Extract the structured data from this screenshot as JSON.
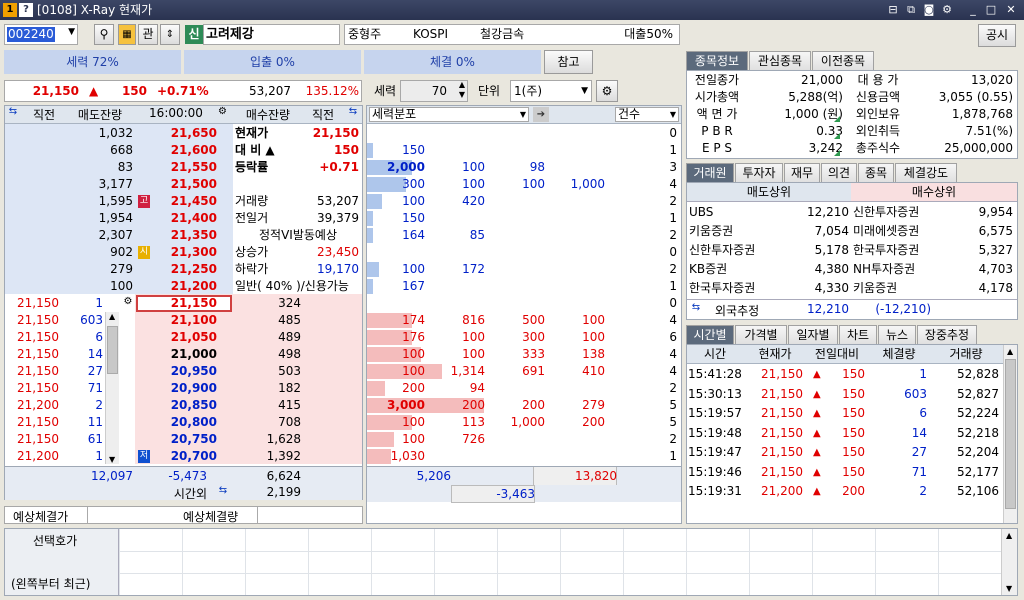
{
  "window": {
    "title": "[0108] X-Ray 현재가"
  },
  "toolbar": {
    "code": "002240",
    "gwan": "관",
    "sin": "신",
    "name": "고려제강",
    "sector1": "중형주",
    "sector2": "KOSPI",
    "sector3": "철강금속",
    "loan": "대출50%",
    "gongsi": "공시",
    "chamgo": "참고"
  },
  "power": {
    "seryeok": "세력 72%",
    "ipchul": "입출 0%",
    "chegyeol": "체결 0%"
  },
  "price_line": {
    "price": "21,150",
    "arrow": "▲",
    "diff": "150",
    "pct": "+0.71%",
    "volume": "53,207",
    "ratio": "135.12%"
  },
  "seryeok_ctl": {
    "label": "세력",
    "value": "70",
    "unit_label": "단위",
    "unit": "1(주)"
  },
  "hoga_header": {
    "col1": "직전",
    "col2": "매도잔량",
    "time": "16:00:00",
    "col4": "매수잔량",
    "col5": "직전"
  },
  "ask": [
    {
      "qty": "1,032",
      "price": "21,650",
      "mark": ""
    },
    {
      "qty": "668",
      "price": "21,600",
      "mark": ""
    },
    {
      "qty": "83",
      "price": "21,550",
      "mark": ""
    },
    {
      "qty": "3,177",
      "price": "21,500",
      "mark": ""
    },
    {
      "qty": "1,595",
      "price": "21,450",
      "mark": "고"
    },
    {
      "qty": "1,954",
      "price": "21,400",
      "mark": ""
    },
    {
      "qty": "2,307",
      "price": "21,350",
      "mark": ""
    },
    {
      "qty": "902",
      "price": "21,300",
      "mark": "시"
    },
    {
      "qty": "279",
      "price": "21,250",
      "mark": ""
    },
    {
      "qty": "100",
      "price": "21,200",
      "mark": ""
    }
  ],
  "bid": [
    {
      "price": "21,150",
      "qty": "324",
      "mark": ""
    },
    {
      "price": "21,100",
      "qty": "485",
      "mark": ""
    },
    {
      "price": "21,050",
      "qty": "489",
      "mark": ""
    },
    {
      "price": "21,000",
      "qty": "498",
      "mark": ""
    },
    {
      "price": "20,950",
      "qty": "503",
      "mark": ""
    },
    {
      "price": "20,900",
      "qty": "182",
      "mark": ""
    },
    {
      "price": "20,850",
      "qty": "415",
      "mark": ""
    },
    {
      "price": "20,800",
      "qty": "708",
      "mark": ""
    },
    {
      "price": "20,750",
      "qty": "1,628",
      "mark": ""
    },
    {
      "price": "20,700",
      "qty": "1,392",
      "mark": "저"
    }
  ],
  "ticks": [
    {
      "p": "21,150",
      "q": "1"
    },
    {
      "p": "21,150",
      "q": "603"
    },
    {
      "p": "21,150",
      "q": "6"
    },
    {
      "p": "21,150",
      "q": "14"
    },
    {
      "p": "21,150",
      "q": "27"
    },
    {
      "p": "21,150",
      "q": "71"
    },
    {
      "p": "21,200",
      "q": "2"
    },
    {
      "p": "21,150",
      "q": "11"
    },
    {
      "p": "21,150",
      "q": "61"
    },
    {
      "p": "21,200",
      "q": "1"
    }
  ],
  "summary_info": [
    {
      "label": "현재가",
      "value": "21,150",
      "cls": "red bold"
    },
    {
      "label": "대 비 ▲",
      "value": "150",
      "cls": "red bold"
    },
    {
      "label": "등락률",
      "value": "+0.71",
      "cls": "red bold"
    },
    {
      "label": "",
      "value": "",
      "cls": ""
    },
    {
      "label": "거래량",
      "value": "53,207",
      "cls": ""
    },
    {
      "label": "전일거",
      "value": "39,379",
      "cls": ""
    },
    {
      "label": "정적VI발동예상",
      "value": "",
      "cls": ""
    },
    {
      "label": "상승가",
      "value": "23,450",
      "cls": "red"
    },
    {
      "label": "하락가",
      "value": "19,170",
      "cls": "blue"
    },
    {
      "label": "일반( 40% )/신용가능",
      "value": "",
      "cls": ""
    }
  ],
  "totals": {
    "ask_total": "12,097",
    "diff": "-5,473",
    "bid_total": "6,624",
    "after_label": "시간외",
    "after_qty": "2,199"
  },
  "expected": {
    "price_label": "예상체결가",
    "qty_label": "예상체결량"
  },
  "dist_header": {
    "label": "세력분포",
    "count": "건수"
  },
  "dist": [
    {
      "v": [
        "",
        "",
        "",
        ""
      ],
      "cnt": "0"
    },
    {
      "v": [
        "150",
        "",
        "",
        ""
      ],
      "cnt": "1"
    },
    {
      "v": [
        "2,000",
        "100",
        "98",
        ""
      ],
      "cnt": "3"
    },
    {
      "v": [
        "300",
        "100",
        "100",
        "1,000"
      ],
      "cnt": "4"
    },
    {
      "v": [
        "100",
        "420",
        "",
        ""
      ],
      "cnt": "2"
    },
    {
      "v": [
        "150",
        "",
        "",
        ""
      ],
      "cnt": "1"
    },
    {
      "v": [
        "164",
        "85",
        "",
        ""
      ],
      "cnt": "2"
    },
    {
      "v": [
        "",
        "",
        "",
        ""
      ],
      "cnt": "0"
    },
    {
      "v": [
        "100",
        "172",
        "",
        ""
      ],
      "cnt": "2"
    },
    {
      "v": [
        "167",
        "",
        "",
        ""
      ],
      "cnt": "1"
    },
    {
      "v": [
        "",
        "",
        "",
        ""
      ],
      "cnt": "0"
    },
    {
      "v": [
        "174",
        "816",
        "500",
        "100"
      ],
      "cnt": "4"
    },
    {
      "v": [
        "176",
        "100",
        "300",
        "100"
      ],
      "cnt": "6"
    },
    {
      "v": [
        "100",
        "100",
        "333",
        "138"
      ],
      "cnt": "4"
    },
    {
      "v": [
        "100",
        "1,314",
        "691",
        "410"
      ],
      "cnt": "4"
    },
    {
      "v": [
        "200",
        "94",
        "",
        ""
      ],
      "cnt": "2"
    },
    {
      "v": [
        "3,000",
        "200",
        "200",
        "279"
      ],
      "cnt": "5"
    },
    {
      "v": [
        "100",
        "113",
        "1,000",
        "200"
      ],
      "cnt": "5"
    },
    {
      "v": [
        "100",
        "726",
        "",
        ""
      ],
      "cnt": "2"
    },
    {
      "v": [
        "1,030",
        "",
        "",
        ""
      ],
      "cnt": "1"
    }
  ],
  "dist_bars": [
    0,
    0.04,
    0.3,
    0.26,
    0.1,
    0.04,
    0.04,
    0,
    0.08,
    0.04,
    0,
    0.3,
    0.3,
    0.36,
    0.5,
    0.12,
    0.78,
    0.3,
    0.18,
    0.16
  ],
  "dist_total": {
    "ask": "5,206",
    "bid": "13,820",
    "diff": "-3,463"
  },
  "info_tabs": [
    "종목정보",
    "관심종목",
    "이전종목"
  ],
  "info": [
    [
      "전일종가",
      "21,000",
      "대 용 가",
      "13,020"
    ],
    [
      "시가총액",
      "5,288(억)",
      "신용금액",
      "3,055  (0.55)"
    ],
    [
      "액 면 가",
      "1,000 (원)",
      "외인보유",
      "1,878,768"
    ],
    [
      "P B R",
      "0.33",
      "외인취득",
      "7.51(%)"
    ],
    [
      "E P S",
      "3,242",
      "총주식수",
      "25,000,000"
    ]
  ],
  "broker_tabs": [
    "거래원",
    "투자자",
    "재무",
    "의견",
    "종목",
    "체결강도"
  ],
  "broker": {
    "sell_title": "매도상위",
    "buy_title": "매수상위",
    "rows": [
      [
        "UBS",
        "12,210",
        "신한투자증권",
        "9,954"
      ],
      [
        "키움증권",
        "7,054",
        "미래에셋증권",
        "6,575"
      ],
      [
        "신한투자증권",
        "5,178",
        "한국투자증권",
        "5,327"
      ],
      [
        "KB증권",
        "4,380",
        "NH투자증권",
        "4,703"
      ],
      [
        "한국투자증권",
        "4,330",
        "키움증권",
        "4,178"
      ]
    ],
    "foreign_label": "외국추정",
    "foreign_sell": "12,210",
    "foreign_buy": "(-12,210)"
  },
  "time_tabs": [
    "시간별",
    "가격별",
    "일자별",
    "차트",
    "뉴스",
    "장중추정"
  ],
  "time_header": [
    "시간",
    "현재가",
    "전일대비",
    "체결량",
    "거래량"
  ],
  "time_rows": [
    [
      "15:41:28",
      "21,150",
      "150",
      "1",
      "52,828"
    ],
    [
      "15:30:13",
      "21,150",
      "150",
      "603",
      "52,827"
    ],
    [
      "15:19:57",
      "21,150",
      "150",
      "6",
      "52,224"
    ],
    [
      "15:19:48",
      "21,150",
      "150",
      "14",
      "52,218"
    ],
    [
      "15:19:47",
      "21,150",
      "150",
      "27",
      "52,204"
    ],
    [
      "15:19:46",
      "21,150",
      "150",
      "71",
      "52,177"
    ],
    [
      "15:19:31",
      "21,200",
      "200",
      "2",
      "52,106"
    ]
  ],
  "bottom": {
    "label1": "선택호가",
    "label2": "(왼쪽부터 최근)"
  },
  "colors": {
    "ask_bg": "#cfdcf1",
    "bid_bg": "#f8d4d4",
    "up": "#e00000",
    "down": "#0020c8"
  }
}
